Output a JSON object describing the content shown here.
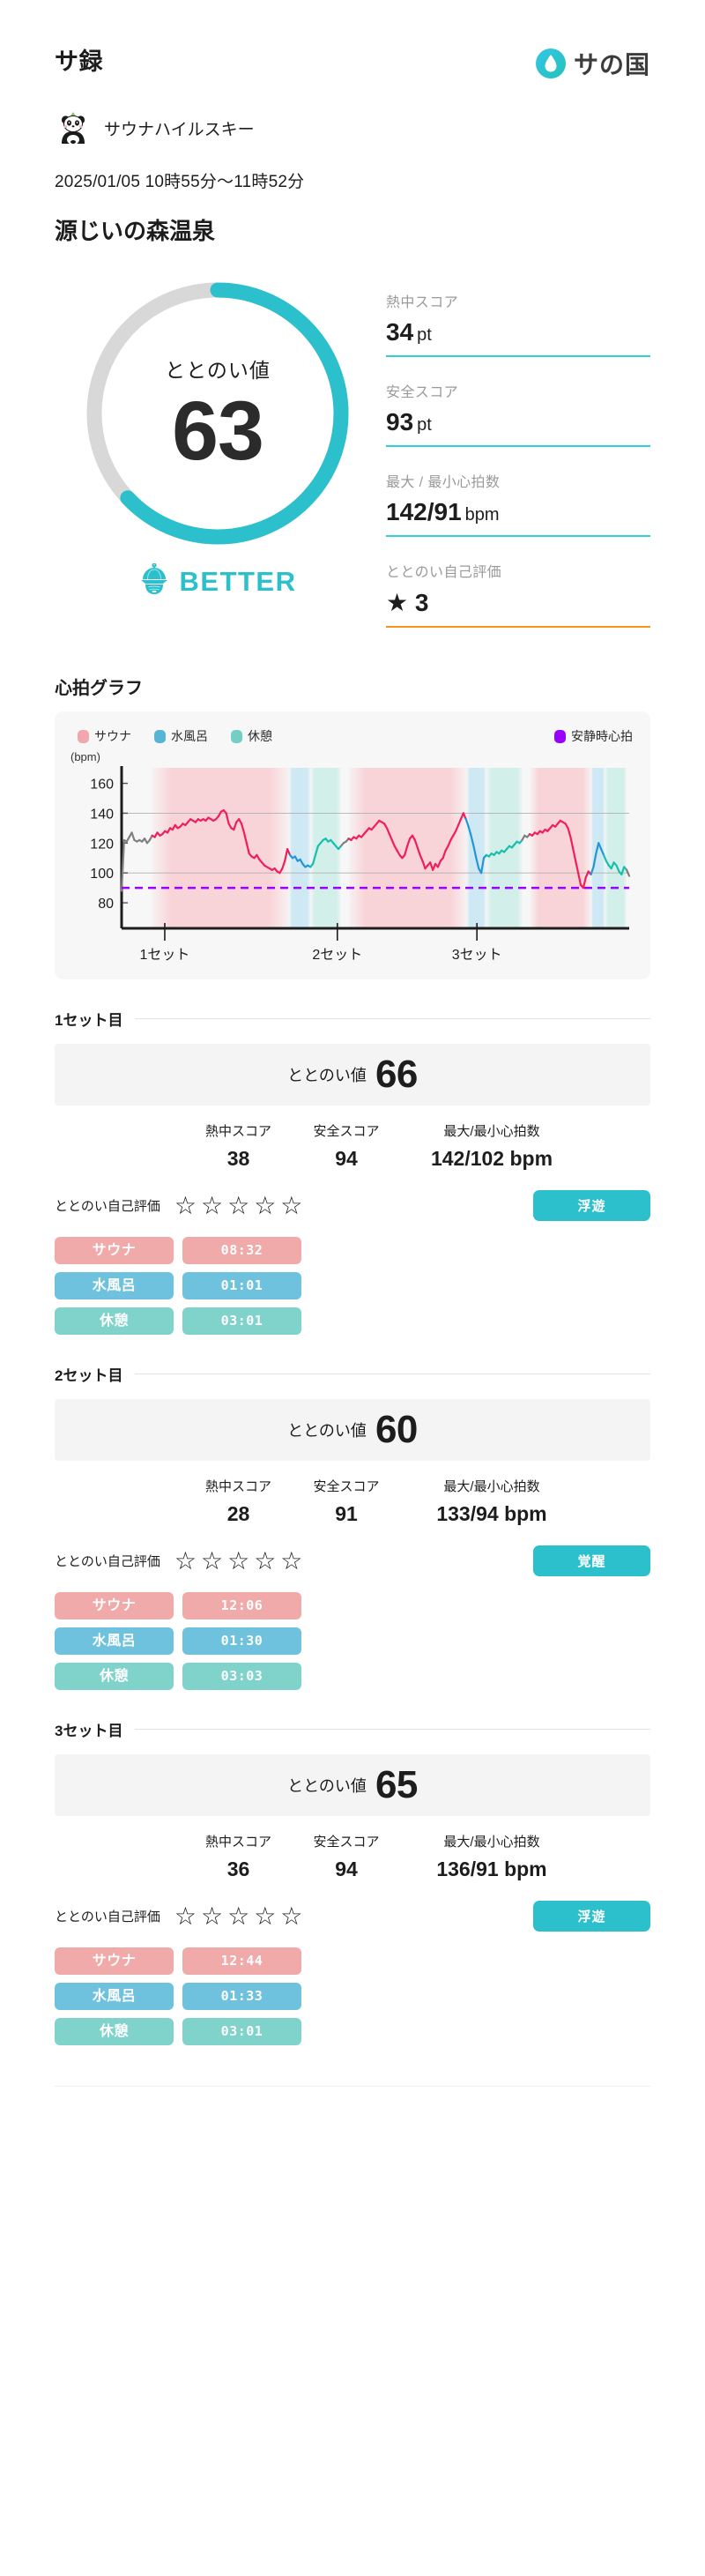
{
  "header": {
    "app_title": "サ録",
    "brand_name": "サの国",
    "brand_icon": "water-drop-icon",
    "brand_color": "#2ec7d6"
  },
  "user": {
    "avatar_icon": "panda-avatar-icon",
    "name": "サウナハイルスキー",
    "datetime": "2025/01/05 10時55分〜11時52分",
    "venue": "源じいの森温泉"
  },
  "summary": {
    "gauge": {
      "label": "ととのい値",
      "value": "63",
      "percent": 63,
      "track_color": "#d8d8d8",
      "arc_color": "#2cc0cc"
    },
    "rank": {
      "icon": "sauna-hat-icon",
      "text": "BETTER",
      "color": "#2cc0cc"
    },
    "metrics": [
      {
        "label": "熱中スコア",
        "value": "34",
        "unit": "pt",
        "rule_color": "#2ed0da"
      },
      {
        "label": "安全スコア",
        "value": "93",
        "unit": "pt",
        "rule_color": "#2ed0da"
      },
      {
        "label": "最大 / 最小心拍数",
        "value": "142/91",
        "unit": "bpm",
        "rule_color": "#2ed0da"
      },
      {
        "label": "ととのい自己評価",
        "value": "★ 3",
        "unit": "",
        "rule_color": "#f6921e"
      }
    ]
  },
  "chart_section": {
    "title": "心拍グラフ",
    "legend": [
      {
        "label": "サウナ",
        "color": "#f0a8ae"
      },
      {
        "label": "水風呂",
        "color": "#55b5d4"
      },
      {
        "label": "休憩",
        "color": "#73cfc4"
      }
    ],
    "legend_right": {
      "label": "安静時心拍",
      "color": "#9900ff"
    }
  },
  "chart_data": {
    "type": "line",
    "title": "心拍グラフ",
    "ylabel": "(bpm)",
    "xlabel": "",
    "ylim": [
      70,
      168
    ],
    "yticks": [
      80,
      100,
      120,
      140,
      160
    ],
    "gridlines": [
      100,
      140
    ],
    "xticks": [
      "1セット",
      "2セット",
      "3セット"
    ],
    "xtick_positions": [
      0.085,
      0.425,
      0.7
    ],
    "resting_hr": 90,
    "resting_hr_color": "#9900ff",
    "series_colors": {
      "sauna_line": "#f01f5c",
      "sauna_fill": "#f8d4d8",
      "bath_line": "#2196d8",
      "bath_fill": "#d4ecf5",
      "rest_line": "#18bfae",
      "rest_fill": "#d3efe9",
      "transition_line": "#808080"
    },
    "phases": [
      {
        "type": "sauna",
        "x_start": 0.06,
        "x_end": 0.33
      },
      {
        "type": "bath",
        "x_start": 0.33,
        "x_end": 0.372
      },
      {
        "type": "rest",
        "x_start": 0.372,
        "x_end": 0.432
      },
      {
        "type": "sauna",
        "x_start": 0.448,
        "x_end": 0.68
      },
      {
        "type": "bath",
        "x_start": 0.68,
        "x_end": 0.718
      },
      {
        "type": "rest",
        "x_start": 0.718,
        "x_end": 0.79
      },
      {
        "type": "sauna",
        "x_start": 0.805,
        "x_end": 0.925
      },
      {
        "type": "bath",
        "x_start": 0.925,
        "x_end": 0.952
      },
      {
        "type": "rest",
        "x_start": 0.952,
        "x_end": 0.995
      }
    ],
    "hr_values": [
      88,
      122,
      121,
      124,
      127,
      122,
      121,
      122,
      121,
      123,
      120,
      122,
      125,
      124,
      127,
      125,
      126,
      128,
      127,
      130,
      129,
      132,
      130,
      131,
      133,
      132,
      134,
      136,
      135,
      134,
      136,
      135,
      136,
      135,
      137,
      136,
      135,
      136,
      138,
      141,
      142,
      140,
      133,
      130,
      129,
      134,
      136,
      133,
      127,
      120,
      113,
      111,
      110,
      112,
      109,
      107,
      105,
      104,
      103,
      102,
      103,
      101,
      100,
      103,
      108,
      116,
      112,
      110,
      111,
      108,
      109,
      106,
      104,
      105,
      104,
      106,
      112,
      118,
      120,
      122,
      123,
      121,
      122,
      120,
      118,
      116,
      118,
      120,
      121,
      123,
      122,
      124,
      123,
      125,
      124,
      126,
      128,
      130,
      129,
      131,
      133,
      135,
      134,
      133,
      130,
      126,
      122,
      118,
      115,
      112,
      110,
      112,
      118,
      123,
      125,
      122,
      117,
      112,
      108,
      103,
      105,
      107,
      102,
      106,
      104,
      108,
      110,
      115,
      118,
      122,
      125,
      128,
      132,
      136,
      140,
      136,
      131,
      125,
      118,
      110,
      103,
      100,
      110,
      112,
      111,
      113,
      112,
      114,
      113,
      115,
      114,
      116,
      118,
      117,
      119,
      121,
      120,
      122,
      125,
      124,
      126,
      125,
      127,
      126,
      128,
      127,
      129,
      128,
      130,
      132,
      131,
      133,
      135,
      134,
      133,
      130,
      124,
      116,
      108,
      100,
      92,
      90,
      97,
      101,
      99,
      104,
      113,
      120,
      116,
      112,
      108,
      105,
      103,
      107,
      105,
      101,
      99,
      104,
      102,
      98
    ]
  },
  "sets": [
    {
      "heading": "1セット目",
      "score_label": "ととのい値",
      "score_value": "66",
      "metrics": [
        {
          "label": "熱中スコア",
          "value": "38"
        },
        {
          "label": "安全スコア",
          "value": "94"
        },
        {
          "label": "最大/最小心拍数",
          "value": "142/102 bpm"
        }
      ],
      "rating_label": "ととのい自己評価",
      "stars_total": 5,
      "stars_filled": 0,
      "badge": "浮遊",
      "chips": [
        {
          "name": "サウナ",
          "time": "08:32",
          "kind": "sauna"
        },
        {
          "name": "水風呂",
          "time": "01:01",
          "kind": "bath"
        },
        {
          "name": "休憩",
          "time": "03:01",
          "kind": "rest"
        }
      ]
    },
    {
      "heading": "2セット目",
      "score_label": "ととのい値",
      "score_value": "60",
      "metrics": [
        {
          "label": "熱中スコア",
          "value": "28"
        },
        {
          "label": "安全スコア",
          "value": "91"
        },
        {
          "label": "最大/最小心拍数",
          "value": "133/94 bpm"
        }
      ],
      "rating_label": "ととのい自己評価",
      "stars_total": 5,
      "stars_filled": 0,
      "badge": "覚醒",
      "chips": [
        {
          "name": "サウナ",
          "time": "12:06",
          "kind": "sauna"
        },
        {
          "name": "水風呂",
          "time": "01:30",
          "kind": "bath"
        },
        {
          "name": "休憩",
          "time": "03:03",
          "kind": "rest"
        }
      ]
    },
    {
      "heading": "3セット目",
      "score_label": "ととのい値",
      "score_value": "65",
      "metrics": [
        {
          "label": "熱中スコア",
          "value": "36"
        },
        {
          "label": "安全スコア",
          "value": "94"
        },
        {
          "label": "最大/最小心拍数",
          "value": "136/91 bpm"
        }
      ],
      "rating_label": "ととのい自己評価",
      "stars_total": 5,
      "stars_filled": 0,
      "badge": "浮遊",
      "chips": [
        {
          "name": "サウナ",
          "time": "12:44",
          "kind": "sauna"
        },
        {
          "name": "水風呂",
          "time": "01:33",
          "kind": "bath"
        },
        {
          "name": "休憩",
          "time": "03:01",
          "kind": "rest"
        }
      ]
    }
  ]
}
